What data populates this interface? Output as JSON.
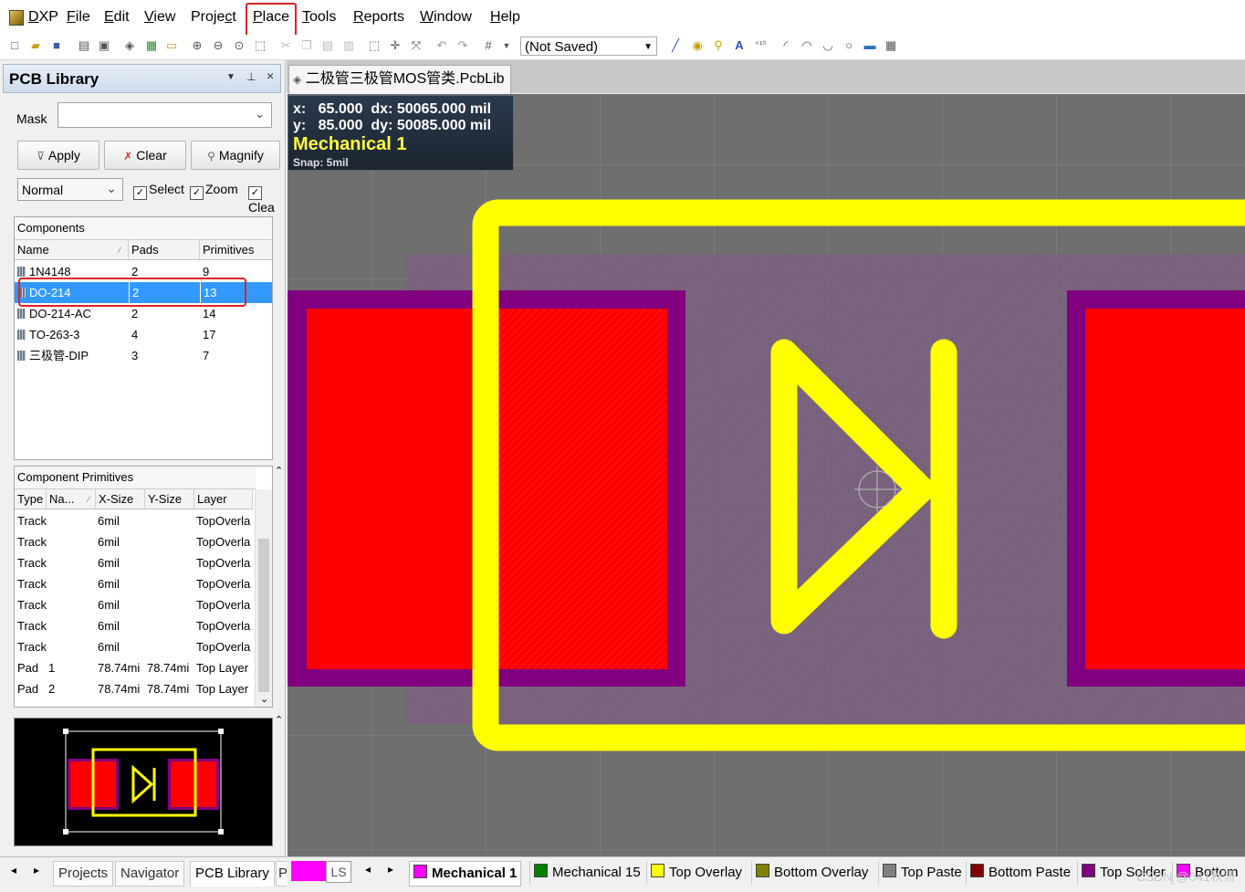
{
  "menu": {
    "items": [
      "DXP",
      "File",
      "Edit",
      "View",
      "Project",
      "Place",
      "Tools",
      "Reports",
      "Window",
      "Help"
    ],
    "underline": [
      "D",
      "F",
      "E",
      "V",
      "c",
      "P",
      "T",
      "R",
      "W",
      "H"
    ]
  },
  "toolbar": {
    "save_state": "(Not Saved)"
  },
  "panel": {
    "title": "PCB Library",
    "mask_label": "Mask",
    "mask_value": "",
    "apply": "Apply",
    "clear": "Clear",
    "magnify": "Magnify",
    "mode": "Normal",
    "select": "Select",
    "zoom": "Zoom",
    "clear_check": "Clea"
  },
  "components": {
    "title": "Components",
    "headers": [
      "Name",
      "Pads",
      "Primitives"
    ],
    "rows": [
      {
        "name": "1N4148",
        "pads": "2",
        "prims": "9"
      },
      {
        "name": "DO-214",
        "pads": "2",
        "prims": "13"
      },
      {
        "name": "DO-214-AC",
        "pads": "2",
        "prims": "14"
      },
      {
        "name": "TO-263-3",
        "pads": "4",
        "prims": "17"
      },
      {
        "name": "三极管-DIP",
        "pads": "3",
        "prims": "7"
      }
    ]
  },
  "primitives": {
    "title": "Component Primitives",
    "headers": [
      "Type",
      "Na...",
      "X-Size",
      "Y-Size",
      "Layer"
    ],
    "rows": [
      {
        "type": "Track",
        "name": "",
        "x": "6mil",
        "y": "",
        "layer": "TopOverla"
      },
      {
        "type": "Track",
        "name": "",
        "x": "6mil",
        "y": "",
        "layer": "TopOverla"
      },
      {
        "type": "Track",
        "name": "",
        "x": "6mil",
        "y": "",
        "layer": "TopOverla"
      },
      {
        "type": "Track",
        "name": "",
        "x": "6mil",
        "y": "",
        "layer": "TopOverla"
      },
      {
        "type": "Track",
        "name": "",
        "x": "6mil",
        "y": "",
        "layer": "TopOverla"
      },
      {
        "type": "Track",
        "name": "",
        "x": "6mil",
        "y": "",
        "layer": "TopOverla"
      },
      {
        "type": "Track",
        "name": "",
        "x": "6mil",
        "y": "",
        "layer": "TopOverla"
      },
      {
        "type": "Pad",
        "name": "1",
        "x": "78.74mi",
        "y": "78.74mi",
        "layer": "Top Layer"
      },
      {
        "type": "Pad",
        "name": "2",
        "x": "78.74mi",
        "y": "78.74mi",
        "layer": "Top Layer"
      }
    ]
  },
  "panel_tabs": [
    "Projects",
    "Navigator",
    "PCB Library",
    "P"
  ],
  "document": {
    "tab": "二极管三极管MOS管类.PcbLib"
  },
  "hud": {
    "x_label": "x:",
    "x": "65.000",
    "dx_label": "dx:",
    "dx": "50065.000 mil",
    "y_label": "y:",
    "y": "85.000",
    "dy_label": "dy:",
    "dy": "50085.000 mil",
    "layer": "Mechanical 1",
    "snap": "Snap: 5mil"
  },
  "layers": {
    "ls": "LS",
    "tabs": [
      {
        "name": "Mechanical 1",
        "color": "#ff00ff",
        "active": true
      },
      {
        "name": "Mechanical 15",
        "color": "#008000"
      },
      {
        "name": "Top Overlay",
        "color": "#ffff00"
      },
      {
        "name": "Bottom Overlay",
        "color": "#808000"
      },
      {
        "name": "Top Paste",
        "color": "#808080"
      },
      {
        "name": "Bottom Paste",
        "color": "#800000"
      },
      {
        "name": "Top Solder",
        "color": "#800080"
      },
      {
        "name": "Bottom",
        "color": "#ff00ff"
      }
    ]
  },
  "colors": {
    "pad": "#ff0000",
    "solder_mask": "#800080",
    "overlay": "#ffff00",
    "canvas": "#6f6f6f",
    "selection": "#3399ff",
    "highlight": "#e02020"
  },
  "watermark": "CSDN @641秋哥"
}
